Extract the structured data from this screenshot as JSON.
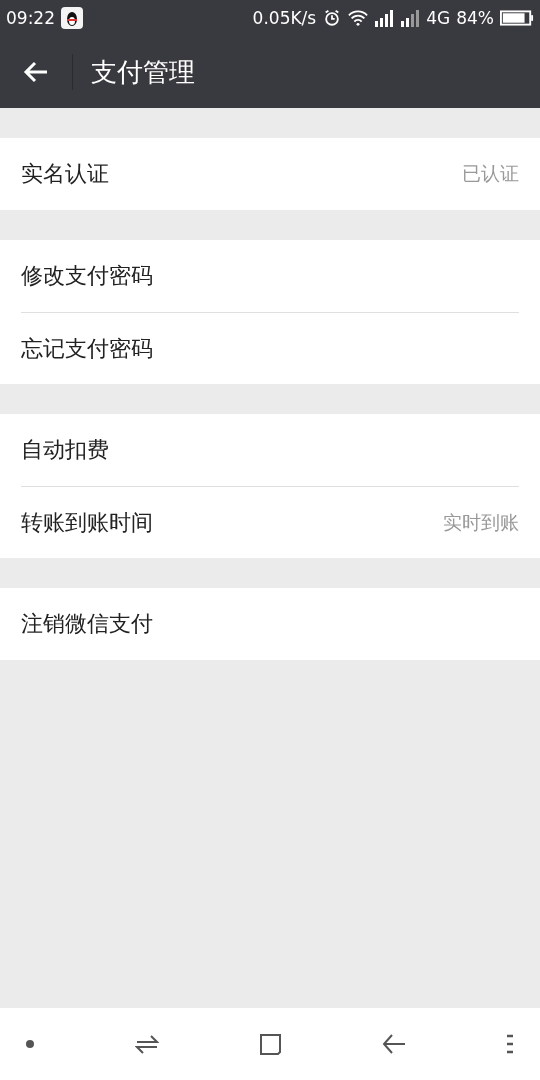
{
  "status_bar": {
    "time": "09:22",
    "net_speed": "0.05K/s",
    "network": "4G",
    "battery": "84%"
  },
  "header": {
    "title": "支付管理"
  },
  "groups": [
    {
      "items": [
        {
          "label": "实名认证",
          "value": "已认证"
        }
      ]
    },
    {
      "items": [
        {
          "label": "修改支付密码"
        },
        {
          "label": "忘记支付密码"
        }
      ]
    },
    {
      "items": [
        {
          "label": "自动扣费"
        },
        {
          "label": "转账到账时间",
          "value": "实时到账"
        }
      ]
    },
    {
      "items": [
        {
          "label": "注销微信支付"
        }
      ]
    }
  ]
}
